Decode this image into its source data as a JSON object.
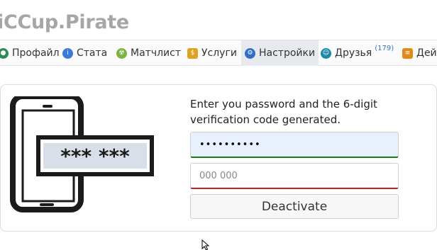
{
  "site": {
    "title": "iCCup.Pirate"
  },
  "nav": {
    "items": [
      {
        "label": "Профайл",
        "icon": "profile-icon",
        "color": "#2e8b57"
      },
      {
        "label": "Стата",
        "icon": "stats-icon",
        "color": "#3a7bd5"
      },
      {
        "label": "Матчлист",
        "icon": "matchlist-icon",
        "color": "#7cb342"
      },
      {
        "label": "Услуги",
        "icon": "services-icon",
        "color": "#e0a020"
      },
      {
        "label": "Настройки",
        "icon": "settings-icon",
        "color": "#2f6fc9",
        "active": true
      },
      {
        "label": "Друзья",
        "icon": "friends-icon",
        "color": "#1e88a8",
        "badge": "(179)"
      },
      {
        "label": "Дей",
        "icon": "actions-icon",
        "color": "#e08a1e"
      }
    ]
  },
  "twofa": {
    "instruction": "Enter you password and the 6-digit verification code generated.",
    "password_value": "••••••••••",
    "code_placeholder": "000 000",
    "deactivate_label": "Deactivate",
    "illustration_text": "*** ***"
  },
  "colors": {
    "valid_border": "#1a7a1a",
    "invalid_border": "#c62020",
    "title_gray": "#a6a6a6"
  }
}
